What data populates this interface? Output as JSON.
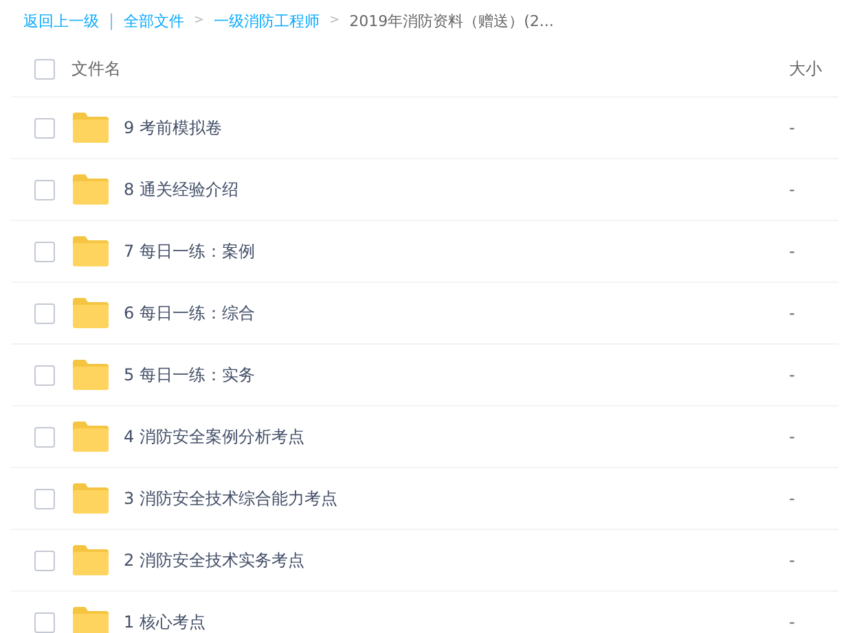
{
  "breadcrumb": {
    "back": "返回上一级",
    "separator": "|",
    "items": [
      {
        "label": "全部文件",
        "link": true
      },
      {
        "label": "一级消防工程师",
        "link": true
      },
      {
        "label": "2019年消防资料（赠送）(2...",
        "link": false
      }
    ],
    "arrow": ">"
  },
  "table": {
    "columns": [
      "文件名",
      "大小"
    ],
    "header_checked": false,
    "rows": [
      {
        "name": "9 考前模拟卷",
        "size": "-",
        "checked": false
      },
      {
        "name": "8 通关经验介绍",
        "size": "-",
        "checked": false
      },
      {
        "name": "7 每日一练：案例",
        "size": "-",
        "checked": false
      },
      {
        "name": "6 每日一练：综合",
        "size": "-",
        "checked": false
      },
      {
        "name": "5 每日一练：实务",
        "size": "-",
        "checked": false
      },
      {
        "name": "4 消防安全案例分析考点",
        "size": "-",
        "checked": false
      },
      {
        "name": "3 消防安全技术综合能力考点",
        "size": "-",
        "checked": false
      },
      {
        "name": "2 消防安全技术实务考点",
        "size": "-",
        "checked": false
      },
      {
        "name": "1 核心考点",
        "size": "-",
        "checked": false
      }
    ]
  }
}
